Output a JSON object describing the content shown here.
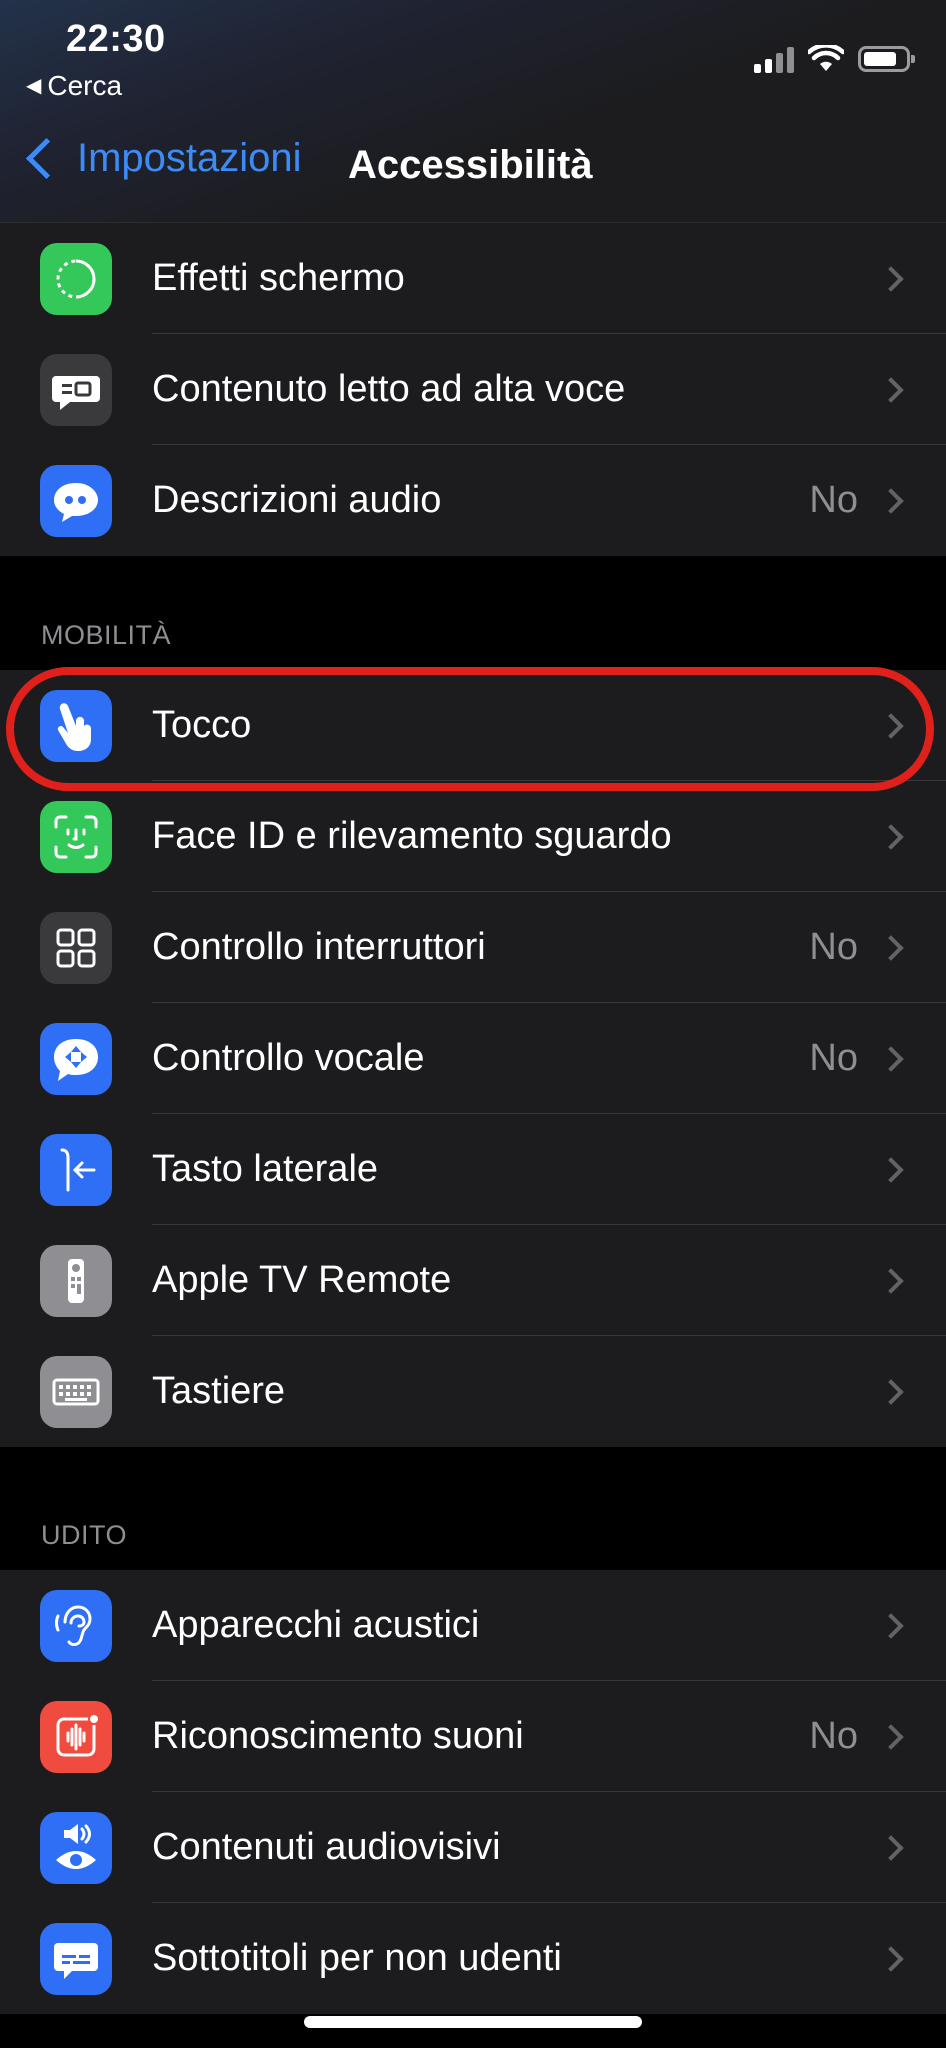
{
  "status_bar": {
    "time": "22:30",
    "back_app": "Cerca"
  },
  "nav": {
    "back_label": "Impostazioni",
    "title": "Accessibilità"
  },
  "group_vision": [
    {
      "label": "Effetti schermo",
      "value": "",
      "icon": "display-effects-icon",
      "color": "#34c759"
    },
    {
      "label": "Contenuto letto ad alta voce",
      "value": "",
      "icon": "spoken-content-icon",
      "color": "#3a3a3c"
    },
    {
      "label": "Descrizioni audio",
      "value": "No",
      "icon": "audio-descriptions-icon",
      "color": "#2f6ff5"
    }
  ],
  "section_mobility": {
    "header": "MOBILITÀ"
  },
  "group_mobility": [
    {
      "label": "Tocco",
      "value": "",
      "icon": "touch-hand-icon",
      "color": "#2f6ff5"
    },
    {
      "label": "Face ID e rilevamento sguardo",
      "value": "",
      "icon": "face-id-icon",
      "color": "#34c759"
    },
    {
      "label": "Controllo interruttori",
      "value": "No",
      "icon": "switch-control-icon",
      "color": "#3a3a3c"
    },
    {
      "label": "Controllo vocale",
      "value": "No",
      "icon": "voice-control-icon",
      "color": "#2f6ff5"
    },
    {
      "label": "Tasto laterale",
      "value": "",
      "icon": "side-button-icon",
      "color": "#2f6ff5"
    },
    {
      "label": "Apple TV Remote",
      "value": "",
      "icon": "tv-remote-icon",
      "color": "#8e8e93"
    },
    {
      "label": "Tastiere",
      "value": "",
      "icon": "keyboard-icon",
      "color": "#8e8e93"
    }
  ],
  "section_hearing": {
    "header": "UDITO"
  },
  "group_hearing": [
    {
      "label": "Apparecchi acustici",
      "value": "",
      "icon": "ear-icon",
      "color": "#2f6ff5"
    },
    {
      "label": "Riconoscimento suoni",
      "value": "No",
      "icon": "sound-recognition-icon",
      "color": "#ef4b3f"
    },
    {
      "label": "Contenuti audiovisivi",
      "value": "",
      "icon": "audiovisual-icon",
      "color": "#2f6ff5"
    },
    {
      "label": "Sottotitoli per non udenti",
      "value": "",
      "icon": "subtitles-icon",
      "color": "#2f6ff5"
    }
  ],
  "highlighted_item": "Tocco"
}
